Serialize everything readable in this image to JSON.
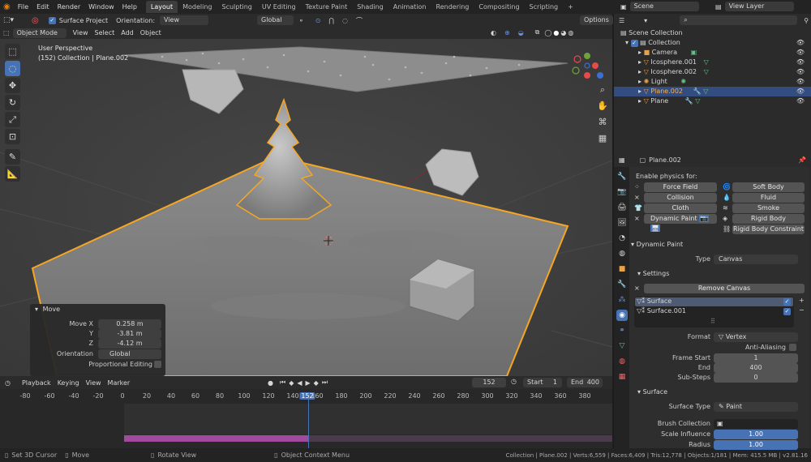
{
  "topbar": {
    "menu": [
      "File",
      "Edit",
      "Render",
      "Window",
      "Help"
    ],
    "workspaces": [
      "Layout",
      "Modeling",
      "Sculpting",
      "UV Editing",
      "Texture Paint",
      "Shading",
      "Animation",
      "Rendering",
      "Compositing",
      "Scripting"
    ],
    "active_workspace": "Layout",
    "scene_label": "Scene",
    "view_layer_label": "View Layer"
  },
  "header": {
    "surface_project": "Surface Project",
    "orientation_label": "Orientation:",
    "orientation_value": "View",
    "transform_space": "Global",
    "options": "Options"
  },
  "viewport_header": {
    "mode": "Object Mode",
    "menus": [
      "View",
      "Select",
      "Add",
      "Object"
    ]
  },
  "viewport": {
    "perspective": "User Perspective",
    "collection_info": "(152) Collection | Plane.002"
  },
  "move_panel": {
    "title": "Move",
    "move_x_label": "Move X",
    "move_x": "0.258 m",
    "y_label": "Y",
    "y": "-3.81 m",
    "z_label": "Z",
    "z": "-4.12 m",
    "orientation_label": "Orientation",
    "orientation_value": "Global",
    "proportional_editing": "Proportional Editing"
  },
  "timeline": {
    "menus": [
      "Playback",
      "Keying",
      "View",
      "Marker"
    ],
    "current_frame": "152",
    "start_label": "Start",
    "start": "1",
    "end_label": "End",
    "end": "400",
    "ticks": [
      "-80",
      "-60",
      "-40",
      "-20",
      "0",
      "20",
      "40",
      "60",
      "80",
      "100",
      "120",
      "140",
      "152",
      "160",
      "180",
      "200",
      "220",
      "240",
      "260",
      "280",
      "300",
      "320",
      "340",
      "360",
      "380"
    ]
  },
  "status_bar": {
    "left": [
      "Set 3D Cursor",
      "Move",
      "Rotate View",
      "Object Context Menu"
    ],
    "stats": "Collection | Plane.002 | Verts:6,559 | Faces:6,409 | Tris:12,778 | Objects:1/181 | Mem: 415.5 MB | v2.81.16"
  },
  "outliner": {
    "scene_collection": "Scene Collection",
    "collection": "Collection",
    "items": [
      "Camera",
      "Icosphere.001",
      "Icosphere.002",
      "Light",
      "Plane.002",
      "Plane"
    ],
    "selected": "Plane.002"
  },
  "properties": {
    "object_name": "Plane.002",
    "enable_physics_for": "Enable physics for:",
    "physics_left": [
      "Force Field",
      "Collision",
      "Cloth",
      "Dynamic Paint"
    ],
    "physics_right": [
      "Soft Body",
      "Fluid",
      "Smoke",
      "Rigid Body",
      "Rigid Body Constraint"
    ],
    "dynamic_paint": "Dynamic Paint",
    "type_label": "Type",
    "type_value": "Canvas",
    "settings": "Settings",
    "remove_canvas": "Remove Canvas",
    "surfaces": [
      "Surface",
      "Surface.001"
    ],
    "format_label": "Format",
    "format_value": "Vertex",
    "anti_aliasing": "Anti-Aliasing",
    "frame_start_label": "Frame Start",
    "frame_start": "1",
    "end_label": "End",
    "end": "400",
    "substeps_label": "Sub-Steps",
    "substeps": "0",
    "surface_section": "Surface",
    "surface_type_label": "Surface Type",
    "surface_type_value": "Paint",
    "brush_collection_label": "Brush Collection",
    "scale_influence_label": "Scale Influence",
    "scale_influence": "1.00",
    "radius_label": "Radius",
    "radius": "1.00"
  },
  "colors": {
    "accent": "#4772b3",
    "selection": "#f5a623",
    "playhead": "#4772b3",
    "range": "#a24a9e"
  }
}
